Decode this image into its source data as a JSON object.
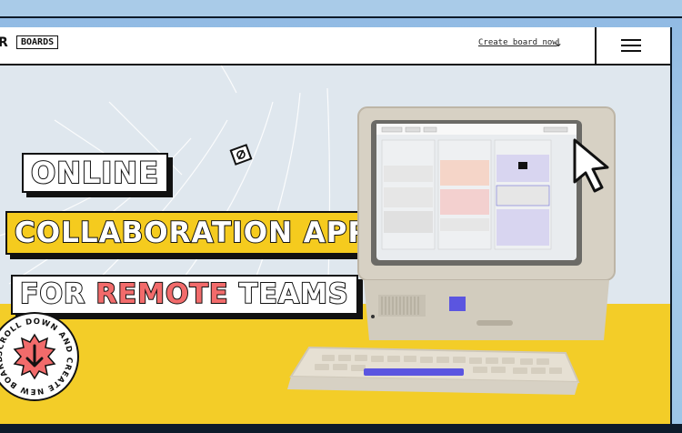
{
  "nav": {
    "logo_letter": "R",
    "logo_text": "BOARDS",
    "create_board_label": "Create board now",
    "create_arrow": "↓",
    "menu_icon": "hamburger-icon"
  },
  "hero": {
    "title_line1": "ONLINE",
    "title_line2": "COLLABORATION APP",
    "title_line3_prefix": "FOR ",
    "title_line3_highlight": "REMOTE",
    "title_line3_suffix": " TEAMS",
    "badge_text": "SCROLL DOWN AND CREATE NEW BOARD",
    "badge_icon": "arrow-down-icon",
    "colors": {
      "accent_yellow": "#f3cd28",
      "accent_red": "#f26b6b",
      "ink": "#111111"
    }
  }
}
